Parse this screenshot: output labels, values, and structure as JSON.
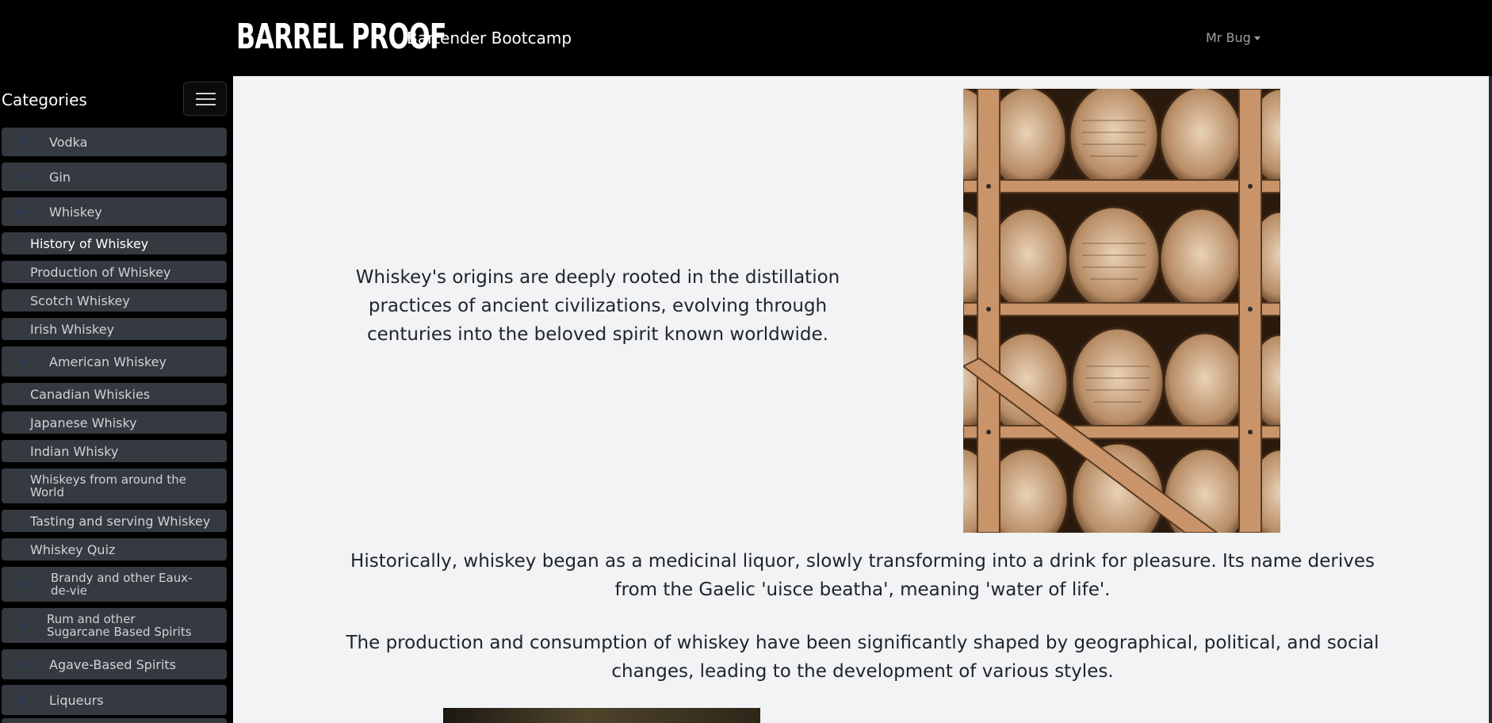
{
  "header": {
    "logo_text": "BARREL PROOF",
    "subtitle": "Bartender Bootcamp",
    "user_name": "Mr Bug"
  },
  "sidebar": {
    "title": "Categories",
    "items": [
      {
        "label": "Vodka",
        "type": "category",
        "chevron": "chevron-right-icon"
      },
      {
        "label": "Gin",
        "type": "category",
        "chevron": "chevron-right-icon"
      },
      {
        "label": "Whiskey",
        "type": "category",
        "chevron": "chevron-down-icon"
      },
      {
        "label": "History of Whiskey",
        "type": "subitem",
        "active": true
      },
      {
        "label": "Production of Whiskey",
        "type": "subitem"
      },
      {
        "label": "Scotch Whiskey",
        "type": "subitem"
      },
      {
        "label": "Irish Whiskey",
        "type": "subitem"
      },
      {
        "label": "American Whiskey",
        "type": "category",
        "chevron": "chevron-right-icon"
      },
      {
        "label": "Canadian Whiskies",
        "type": "subitem"
      },
      {
        "label": "Japanese Whisky",
        "type": "subitem"
      },
      {
        "label": "Indian Whisky",
        "type": "subitem"
      },
      {
        "label": "Whiskeys from around the World",
        "type": "subitem"
      },
      {
        "label": "Tasting and serving Whiskey",
        "type": "subitem"
      },
      {
        "label": "Whiskey Quiz",
        "type": "subitem"
      },
      {
        "label": "Brandy and other Eaux-de-vie",
        "type": "category",
        "chevron": "chevron-right-icon"
      },
      {
        "label": "Rum and other Sugarcane Based Spirits",
        "type": "category",
        "chevron": "chevron-right-icon"
      },
      {
        "label": "Agave-Based Spirits",
        "type": "category",
        "chevron": "chevron-right-icon"
      },
      {
        "label": "Liqueurs",
        "type": "category",
        "chevron": "chevron-right-icon"
      }
    ]
  },
  "content": {
    "intro": "Whiskey's origins are deeply rooted in the distillation practices of ancient civilizations, evolving through centuries into the beloved spirit known worldwide.",
    "para2": "Historically, whiskey began as a medicinal liquor, slowly transforming into a drink for pleasure. Its name derives from the Gaelic 'uisce beatha', meaning 'water of life'.",
    "para3": "The production and consumption of whiskey have been significantly shaped by geographical, political, and social changes, leading to the development of various styles."
  },
  "colors": {
    "header_bg": "#000000",
    "sidebar_item_bg": "#343a40",
    "content_bg": "#f1f3f5",
    "chevron": "#1f3b73"
  }
}
